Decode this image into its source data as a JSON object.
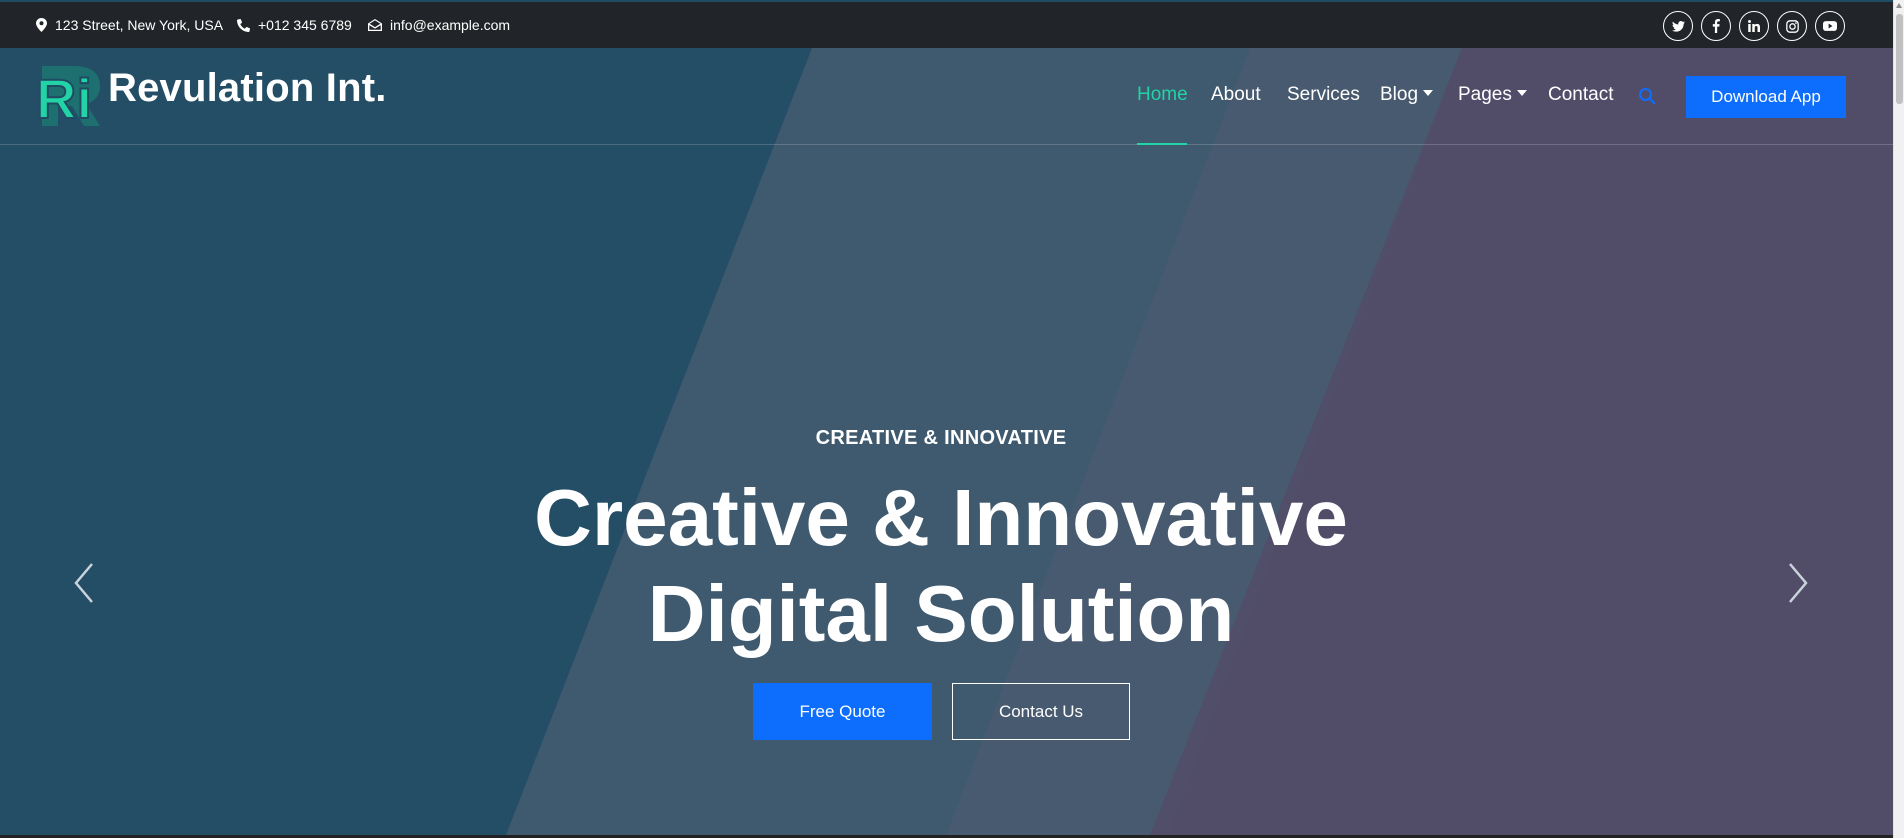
{
  "topbar": {
    "address": "123 Street, New York, USA",
    "phone": "+012 345 6789",
    "email": "info@example.com",
    "social": [
      "twitter-icon",
      "facebook-icon",
      "linkedin-icon",
      "instagram-icon",
      "youtube-icon"
    ]
  },
  "brand": {
    "logo_text": "Ri",
    "name": "Revulation Int."
  },
  "nav": {
    "items": [
      {
        "label": "Home",
        "active": true
      },
      {
        "label": "About"
      },
      {
        "label": "Services"
      },
      {
        "label": "Blog",
        "dropdown": true
      },
      {
        "label": "Pages",
        "dropdown": true
      },
      {
        "label": "Contact"
      }
    ],
    "download_label": "Download App"
  },
  "hero": {
    "kicker": "CREATIVE & INNOVATIVE",
    "title_line1": "Creative & Innovative",
    "title_line2": "Digital Solution",
    "primary_button": "Free Quote",
    "secondary_button": "Contact Us"
  },
  "colors": {
    "accent": "#22d3a6",
    "primary": "#0d6efd",
    "topbar": "#212529"
  }
}
